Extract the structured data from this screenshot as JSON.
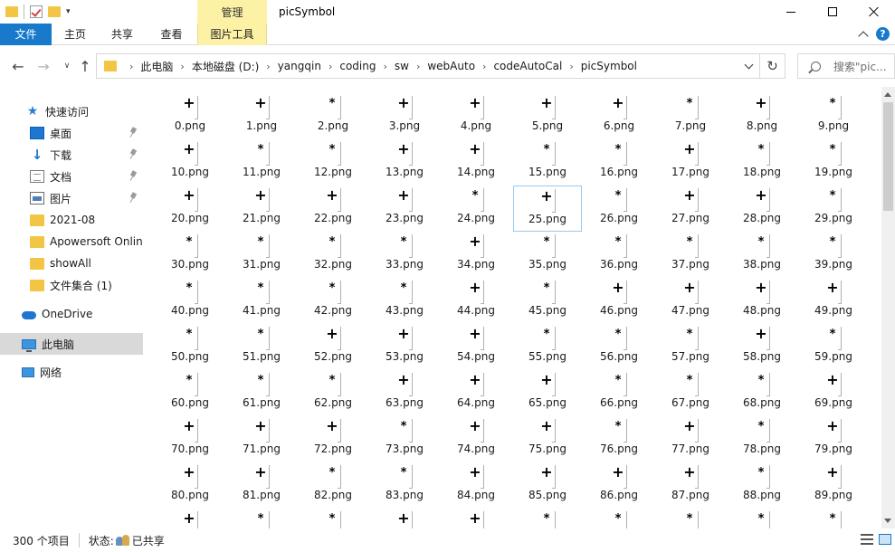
{
  "window": {
    "title": "picSymbol",
    "context_tab": "管理",
    "colors": {
      "file_tab": "#1979ca",
      "context_tab": "#fdf1a6",
      "selection": "#d9d9d9"
    }
  },
  "ribbon": {
    "tabs": [
      "文件",
      "主页",
      "共享",
      "查看",
      "图片工具"
    ]
  },
  "address": {
    "breadcrumbs": [
      "此电脑",
      "本地磁盘 (D:)",
      "yangqin",
      "coding",
      "sw",
      "webAuto",
      "codeAutoCal",
      "picSymbol"
    ],
    "search_placeholder": "搜索\"pic..."
  },
  "sidebar": {
    "items": [
      {
        "label": "快速访问",
        "icon": "star-icon",
        "pinned": false
      },
      {
        "label": "桌面",
        "icon": "desktop-icon",
        "pinned": true
      },
      {
        "label": "下载",
        "icon": "download-icon",
        "pinned": true
      },
      {
        "label": "文档",
        "icon": "document-icon",
        "pinned": true
      },
      {
        "label": "图片",
        "icon": "pictures-icon",
        "pinned": true
      },
      {
        "label": "2021-08",
        "icon": "folder-icon",
        "pinned": false
      },
      {
        "label": "Apowersoft Online",
        "icon": "folder-icon",
        "pinned": false
      },
      {
        "label": "showAll",
        "icon": "folder-icon",
        "pinned": false
      },
      {
        "label": "文件集合 (1)",
        "icon": "folder-icon",
        "pinned": false
      },
      {
        "label": "OneDrive",
        "icon": "onedrive-icon",
        "pinned": false
      },
      {
        "label": "此电脑",
        "icon": "this-pc-icon",
        "pinned": false,
        "selected": true
      },
      {
        "label": "网络",
        "icon": "network-icon",
        "pinned": false
      }
    ]
  },
  "files": {
    "items": [
      {
        "name": "0.png",
        "symbol": "+"
      },
      {
        "name": "1.png",
        "symbol": "+"
      },
      {
        "name": "2.png",
        "symbol": "*"
      },
      {
        "name": "3.png",
        "symbol": "+"
      },
      {
        "name": "4.png",
        "symbol": "+"
      },
      {
        "name": "5.png",
        "symbol": "+"
      },
      {
        "name": "6.png",
        "symbol": "+"
      },
      {
        "name": "7.png",
        "symbol": "*"
      },
      {
        "name": "8.png",
        "symbol": "+"
      },
      {
        "name": "9.png",
        "symbol": "*"
      },
      {
        "name": "10.png",
        "symbol": "+"
      },
      {
        "name": "11.png",
        "symbol": "*"
      },
      {
        "name": "12.png",
        "symbol": "*"
      },
      {
        "name": "13.png",
        "symbol": "+"
      },
      {
        "name": "14.png",
        "symbol": "+"
      },
      {
        "name": "15.png",
        "symbol": "*"
      },
      {
        "name": "16.png",
        "symbol": "*"
      },
      {
        "name": "17.png",
        "symbol": "+"
      },
      {
        "name": "18.png",
        "symbol": "*"
      },
      {
        "name": "19.png",
        "symbol": "*"
      },
      {
        "name": "20.png",
        "symbol": "+"
      },
      {
        "name": "21.png",
        "symbol": "+"
      },
      {
        "name": "22.png",
        "symbol": "+"
      },
      {
        "name": "23.png",
        "symbol": "+"
      },
      {
        "name": "24.png",
        "symbol": "*"
      },
      {
        "name": "25.png",
        "symbol": "+",
        "selected": true
      },
      {
        "name": "26.png",
        "symbol": "*"
      },
      {
        "name": "27.png",
        "symbol": "+"
      },
      {
        "name": "28.png",
        "symbol": "+"
      },
      {
        "name": "29.png",
        "symbol": "*"
      },
      {
        "name": "30.png",
        "symbol": "*"
      },
      {
        "name": "31.png",
        "symbol": "*"
      },
      {
        "name": "32.png",
        "symbol": "*"
      },
      {
        "name": "33.png",
        "symbol": "*"
      },
      {
        "name": "34.png",
        "symbol": "+"
      },
      {
        "name": "35.png",
        "symbol": "*"
      },
      {
        "name": "36.png",
        "symbol": "*"
      },
      {
        "name": "37.png",
        "symbol": "*"
      },
      {
        "name": "38.png",
        "symbol": "*"
      },
      {
        "name": "39.png",
        "symbol": "*"
      },
      {
        "name": "40.png",
        "symbol": "*"
      },
      {
        "name": "41.png",
        "symbol": "*"
      },
      {
        "name": "42.png",
        "symbol": "*"
      },
      {
        "name": "43.png",
        "symbol": "*"
      },
      {
        "name": "44.png",
        "symbol": "+"
      },
      {
        "name": "45.png",
        "symbol": "*"
      },
      {
        "name": "46.png",
        "symbol": "+"
      },
      {
        "name": "47.png",
        "symbol": "+"
      },
      {
        "name": "48.png",
        "symbol": "+"
      },
      {
        "name": "49.png",
        "symbol": "+"
      },
      {
        "name": "50.png",
        "symbol": "*"
      },
      {
        "name": "51.png",
        "symbol": "*"
      },
      {
        "name": "52.png",
        "symbol": "+"
      },
      {
        "name": "53.png",
        "symbol": "+"
      },
      {
        "name": "54.png",
        "symbol": "+"
      },
      {
        "name": "55.png",
        "symbol": "*"
      },
      {
        "name": "56.png",
        "symbol": "*"
      },
      {
        "name": "57.png",
        "symbol": "*"
      },
      {
        "name": "58.png",
        "symbol": "+"
      },
      {
        "name": "59.png",
        "symbol": "*"
      },
      {
        "name": "60.png",
        "symbol": "*"
      },
      {
        "name": "61.png",
        "symbol": "*"
      },
      {
        "name": "62.png",
        "symbol": "*"
      },
      {
        "name": "63.png",
        "symbol": "+"
      },
      {
        "name": "64.png",
        "symbol": "+"
      },
      {
        "name": "65.png",
        "symbol": "+"
      },
      {
        "name": "66.png",
        "symbol": "*"
      },
      {
        "name": "67.png",
        "symbol": "*"
      },
      {
        "name": "68.png",
        "symbol": "*"
      },
      {
        "name": "69.png",
        "symbol": "+"
      },
      {
        "name": "70.png",
        "symbol": "+"
      },
      {
        "name": "71.png",
        "symbol": "+"
      },
      {
        "name": "72.png",
        "symbol": "+"
      },
      {
        "name": "73.png",
        "symbol": "*"
      },
      {
        "name": "74.png",
        "symbol": "+"
      },
      {
        "name": "75.png",
        "symbol": "+"
      },
      {
        "name": "76.png",
        "symbol": "*"
      },
      {
        "name": "77.png",
        "symbol": "+"
      },
      {
        "name": "78.png",
        "symbol": "*"
      },
      {
        "name": "79.png",
        "symbol": "+"
      },
      {
        "name": "80.png",
        "symbol": "+"
      },
      {
        "name": "81.png",
        "symbol": "+"
      },
      {
        "name": "82.png",
        "symbol": "*"
      },
      {
        "name": "83.png",
        "symbol": "*"
      },
      {
        "name": "84.png",
        "symbol": "+"
      },
      {
        "name": "85.png",
        "symbol": "+"
      },
      {
        "name": "86.png",
        "symbol": "+"
      },
      {
        "name": "87.png",
        "symbol": "+"
      },
      {
        "name": "88.png",
        "symbol": "*"
      },
      {
        "name": "89.png",
        "symbol": "+"
      },
      {
        "name": "",
        "symbol": "+"
      },
      {
        "name": "",
        "symbol": "*"
      },
      {
        "name": "",
        "symbol": "*"
      },
      {
        "name": "",
        "symbol": "+"
      },
      {
        "name": "",
        "symbol": "+"
      },
      {
        "name": "",
        "symbol": "*"
      },
      {
        "name": "",
        "symbol": "*"
      },
      {
        "name": "",
        "symbol": "*"
      },
      {
        "name": "",
        "symbol": "*"
      },
      {
        "name": "",
        "symbol": "*"
      }
    ]
  },
  "status": {
    "item_count": "300 个项目",
    "share_label": "状态:",
    "share_value": "已共享"
  }
}
